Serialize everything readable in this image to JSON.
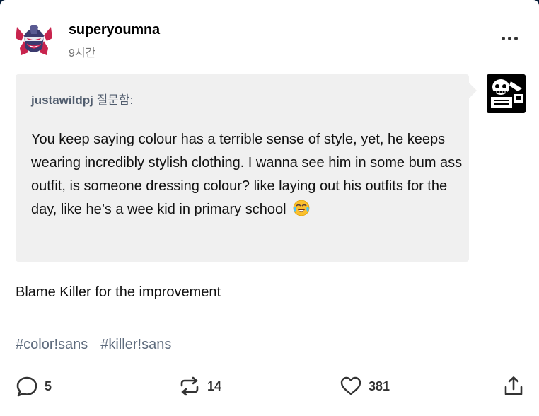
{
  "post": {
    "author": "superyoumna",
    "timestamp": "9시간",
    "avatar_icon": "demon-helmet-avatar"
  },
  "ask": {
    "asker_name": "justawildpj",
    "asker_suffix": " 질문함:",
    "question_text": "You keep saying colour has a terrible sense of style, yet, he keeps wearing incredibly stylish clothing. I wanna see him in some bum ass outfit, is someone dressing colour? like laying out his outfits for the day, like he’s a wee kid in primary school",
    "emoji_icon": "face-with-tears-of-joy-icon",
    "asker_avatar_icon": "skeleton-avatar"
  },
  "answer": {
    "text": "Blame Killer for the improvement"
  },
  "tags": [
    "#color!sans",
    "#killer!sans"
  ],
  "footer": {
    "replies": "5",
    "reblogs": "14",
    "likes": "381"
  },
  "colors": {
    "ask_background": "#f0f0f0",
    "tag_color": "#5e6b7d",
    "secondary_text": "#737373"
  }
}
